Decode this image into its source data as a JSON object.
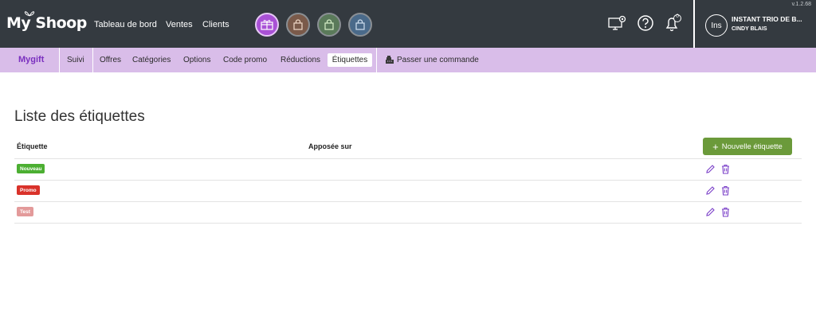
{
  "header": {
    "logo_text": "My Shoop",
    "version": "v.1.2.68",
    "nav": [
      "Tableau de bord",
      "Ventes",
      "Clients"
    ],
    "notification_count": "0",
    "avatar_initials": "Ins",
    "shop_name": "INSTANT TRIO DE B...",
    "user_name": "CINDY BLAIS",
    "colors": {
      "bg": "#343a40",
      "gift": "#a951d6",
      "brown": "#7a5a4a",
      "green": "#5a7a5a",
      "blue": "#4a6a8a"
    }
  },
  "subnav": {
    "brand": "Mygift",
    "items": [
      "Suivi",
      "Offres",
      "Catégories",
      "Options",
      "Code promo",
      "Réductions"
    ],
    "active": "Étiquettes",
    "order": "Passer une commande"
  },
  "main": {
    "title": "Liste des étiquettes",
    "columns": [
      "Étiquette",
      "Apposée sur"
    ],
    "new_button": "Nouvelle étiquette",
    "rows": [
      {
        "label": "Nouveau",
        "color": "#4caf32"
      },
      {
        "label": "Promo",
        "color": "#d9322a"
      },
      {
        "label": "Test",
        "color": "#e39a9a"
      }
    ]
  }
}
